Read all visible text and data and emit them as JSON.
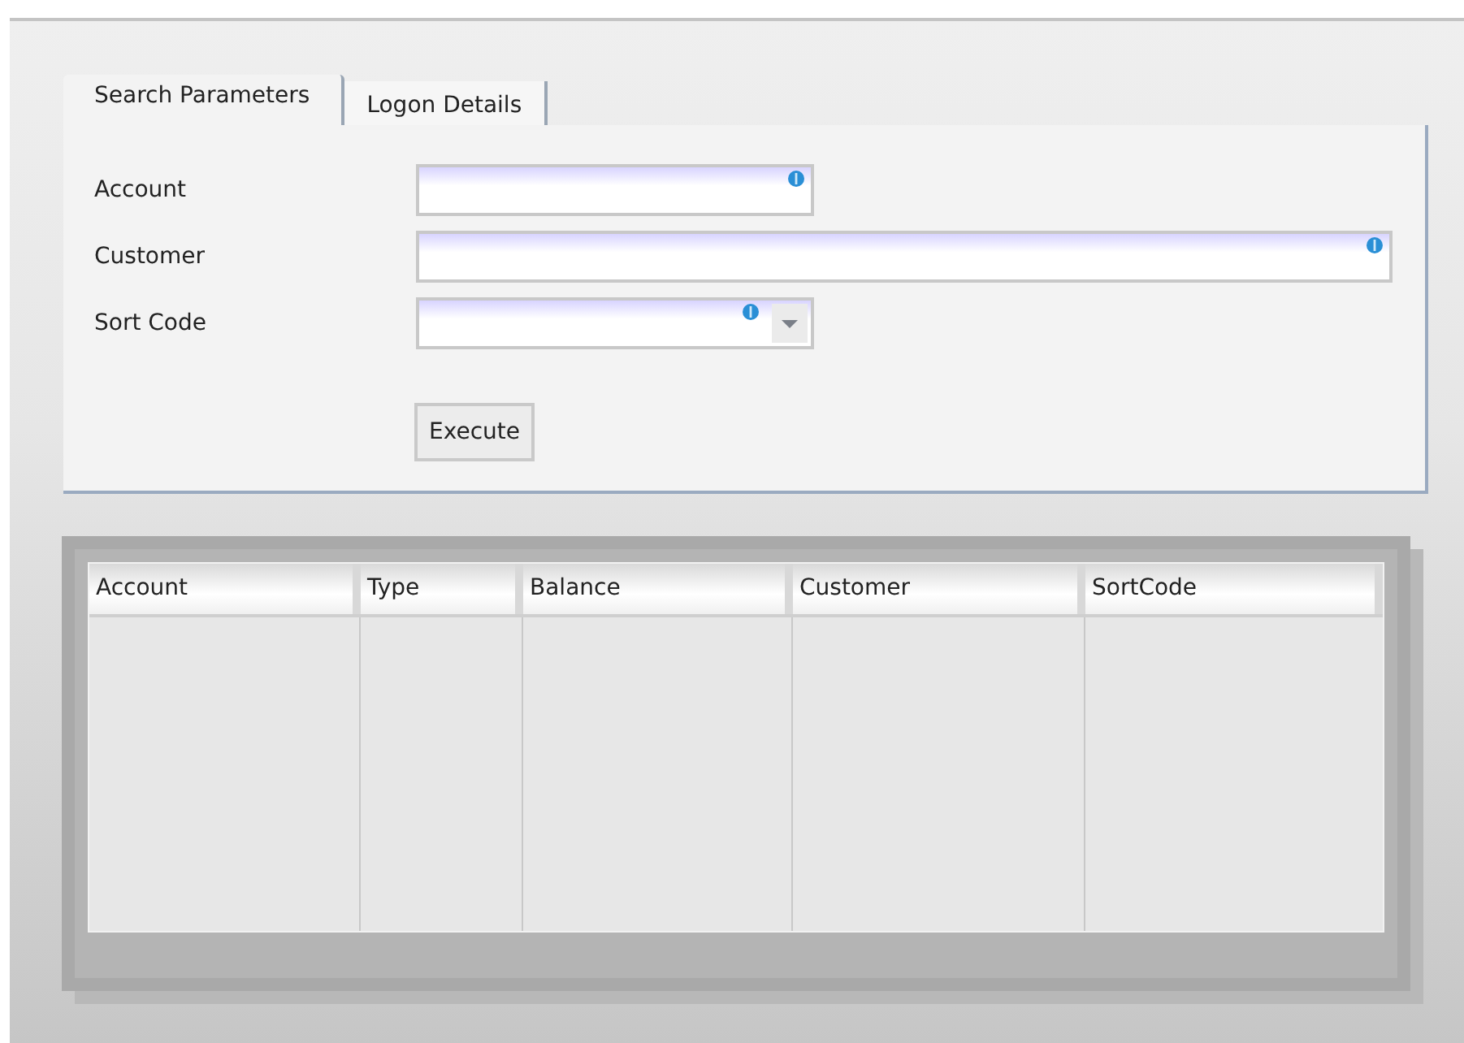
{
  "tabs": [
    {
      "label": "Search Parameters",
      "selected": true
    },
    {
      "label": "Logon Details",
      "selected": false
    }
  ],
  "form": {
    "fields": [
      {
        "label": "Account",
        "kind": "text",
        "wide": false
      },
      {
        "label": "Customer",
        "kind": "text",
        "wide": true
      },
      {
        "label": "Sort Code",
        "kind": "combo",
        "wide": false
      }
    ],
    "button": "Execute"
  },
  "table": {
    "columns": [
      "Account",
      "Type",
      "Balance",
      "Customer",
      "SortCode"
    ]
  }
}
